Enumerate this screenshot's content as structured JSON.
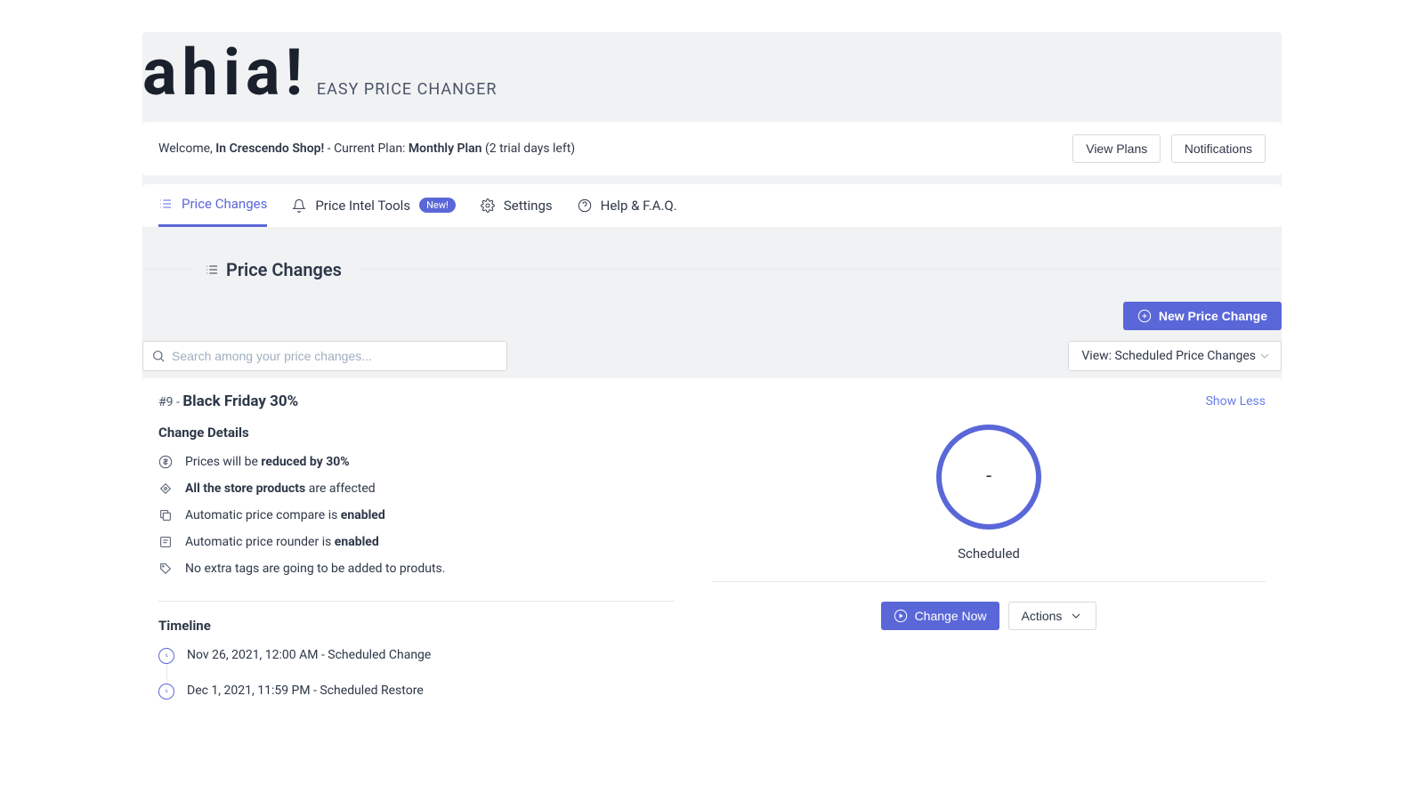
{
  "brand": {
    "logo": "ahia!",
    "tagline": "EASY PRICE CHANGER"
  },
  "welcome": {
    "prefix": "Welcome, ",
    "shop": "In Crescendo Shop!",
    "plan_prefix": " - Current Plan: ",
    "plan": "Monthly Plan",
    "trial": " (2 trial days left)",
    "view_plans": "View Plans",
    "notifications": "Notifications"
  },
  "tabs": {
    "price_changes": "Price Changes",
    "price_intel": "Price Intel Tools",
    "price_intel_badge": "New!",
    "settings": "Settings",
    "help": "Help & F.A.Q."
  },
  "section": {
    "title": "Price Changes"
  },
  "toolbar": {
    "new_price_change": "New Price Change"
  },
  "filters": {
    "search_placeholder": "Search among your price changes...",
    "view_select": "View: Scheduled Price Changes"
  },
  "card": {
    "id": "#9",
    "sep": " - ",
    "name": "Black Friday 30%",
    "show_less": "Show Less",
    "details_heading": "Change Details",
    "d1_pre": "Prices will be ",
    "d1_bold": "reduced by 30%",
    "d2_bold": "All the store products",
    "d2_post": " are affected",
    "d3_pre": "Automatic price compare is ",
    "d3_bold": "enabled",
    "d4_pre": "Automatic price rounder is ",
    "d4_bold": "enabled",
    "d5": "No extra tags are going to be added to produts.",
    "timeline_heading": "Timeline",
    "t1": "Nov 26, 2021, 12:00 AM - Scheduled Change",
    "t2": "Dec 1, 2021, 11:59 PM - Scheduled Restore",
    "status_value": "-",
    "status_label": "Scheduled",
    "change_now": "Change Now",
    "actions": "Actions"
  }
}
